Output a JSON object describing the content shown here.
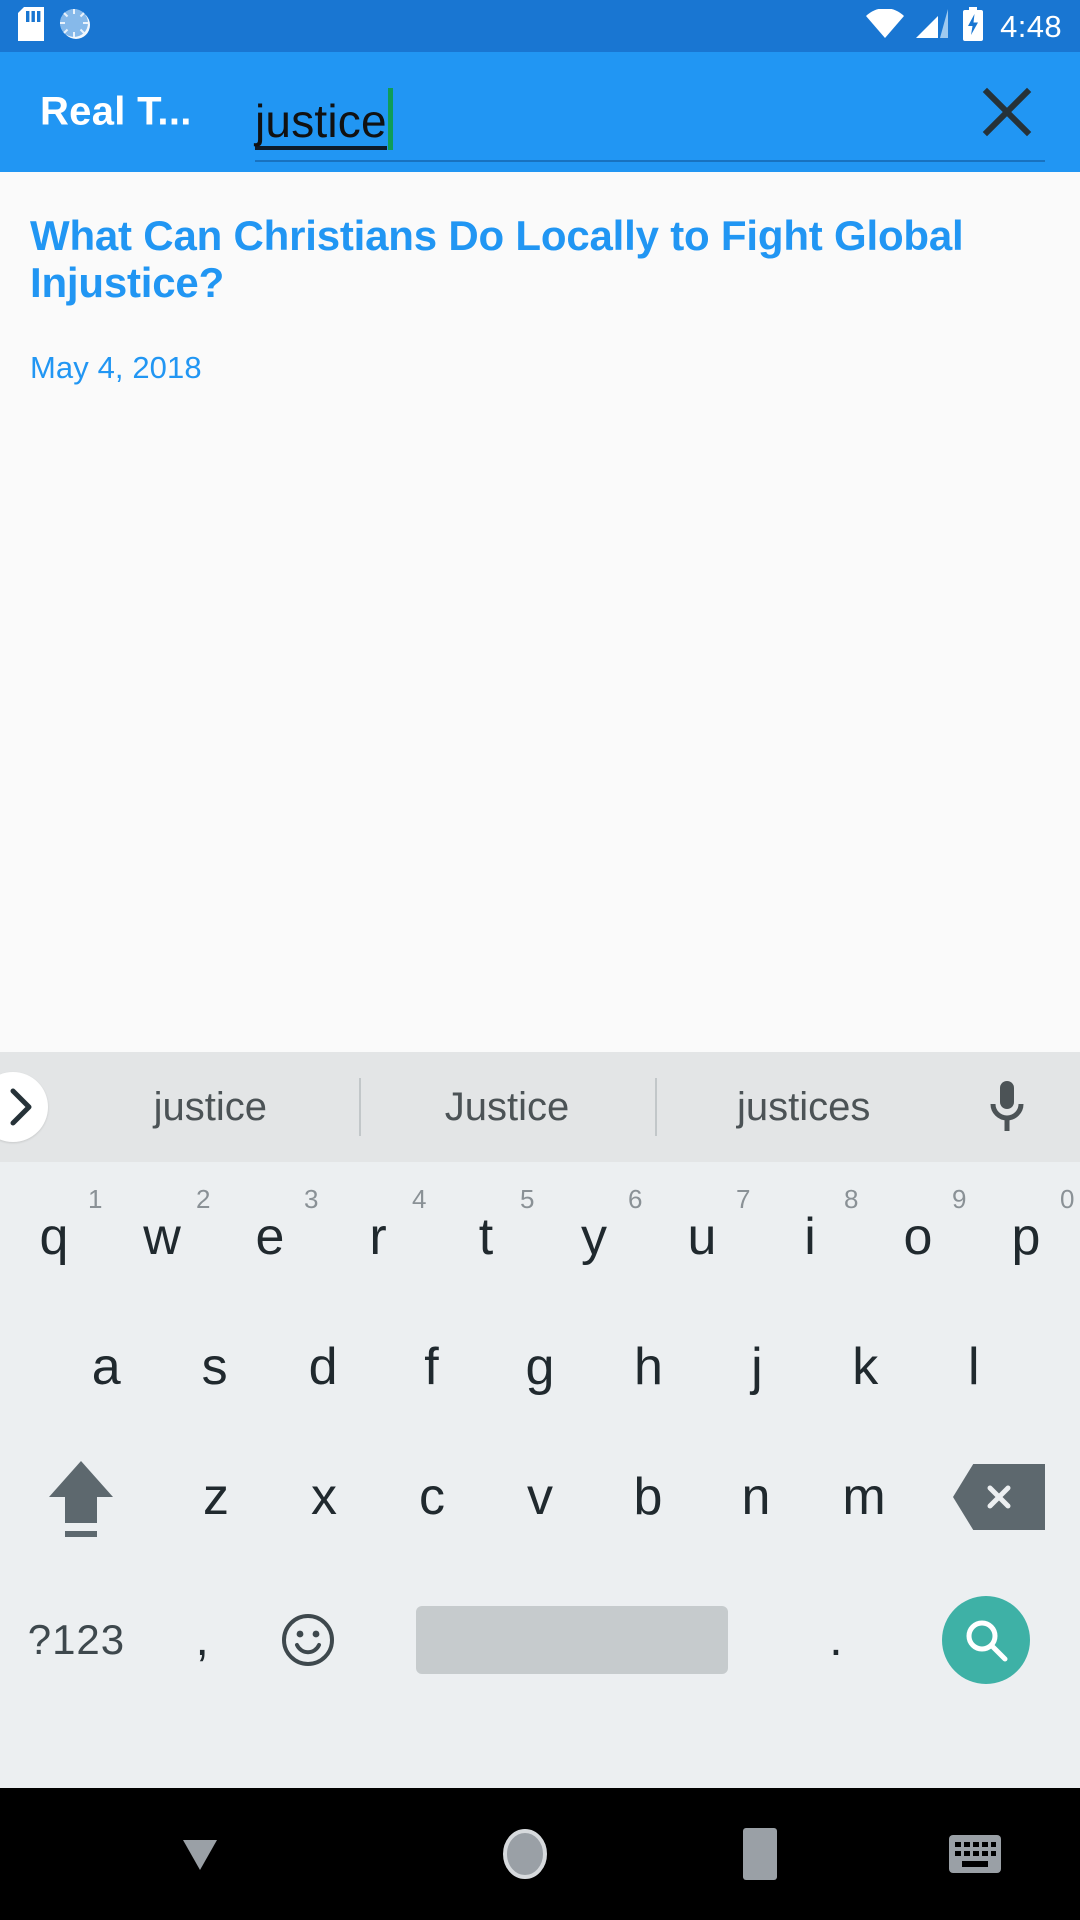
{
  "status_bar": {
    "icons": [
      "sd-card-icon",
      "sync-progress-icon",
      "wifi-icon",
      "cellular-signal-icon",
      "battery-charging-icon"
    ],
    "clock": "4:48",
    "background_color": "#1976d2"
  },
  "toolbar": {
    "app_title": "Real T...",
    "background_color": "#2196f3",
    "clear_icon": "close-icon",
    "search": {
      "value": "justice",
      "placeholder": "Search",
      "caret_color": "#0f9d58"
    }
  },
  "content": {
    "background_color": "#fafafa",
    "accent_color": "#2196f3",
    "results": [
      {
        "title": "What Can Christians Do Locally to Fight Global Injustice?",
        "date": "May 4, 2018"
      }
    ]
  },
  "keyboard": {
    "background_color": "#eceff1",
    "suggestion_strip": {
      "background_color": "#e3e5e6",
      "expand_icon": "chevron-right-icon",
      "voice_icon": "microphone-icon",
      "suggestions": [
        "justice",
        "Justice",
        "justices"
      ]
    },
    "rows": {
      "row1": [
        {
          "key": "q",
          "hint": "1"
        },
        {
          "key": "w",
          "hint": "2"
        },
        {
          "key": "e",
          "hint": "3"
        },
        {
          "key": "r",
          "hint": "4"
        },
        {
          "key": "t",
          "hint": "5"
        },
        {
          "key": "y",
          "hint": "6"
        },
        {
          "key": "u",
          "hint": "7"
        },
        {
          "key": "i",
          "hint": "8"
        },
        {
          "key": "o",
          "hint": "9"
        },
        {
          "key": "p",
          "hint": "0"
        }
      ],
      "row2": [
        {
          "key": "a"
        },
        {
          "key": "s"
        },
        {
          "key": "d"
        },
        {
          "key": "f"
        },
        {
          "key": "g"
        },
        {
          "key": "h"
        },
        {
          "key": "j"
        },
        {
          "key": "k"
        },
        {
          "key": "l"
        }
      ],
      "row3": [
        {
          "key": "z"
        },
        {
          "key": "x"
        },
        {
          "key": "c"
        },
        {
          "key": "v"
        },
        {
          "key": "b"
        },
        {
          "key": "n"
        },
        {
          "key": "m"
        }
      ]
    },
    "shift_icon": "shift-arrow-icon",
    "backspace_icon": "backspace-icon",
    "symbols_label": "?123",
    "comma_label": ",",
    "emoji_icon": "emoji-smiley-icon",
    "space_label": "",
    "period_label": ".",
    "enter_icon": "search-icon",
    "enter_color": "#3eb1a6"
  },
  "nav_bar": {
    "background_color": "#000000",
    "buttons": [
      "hide-keyboard-icon",
      "home-icon",
      "recents-icon",
      "switch-keyboard-icon"
    ]
  }
}
